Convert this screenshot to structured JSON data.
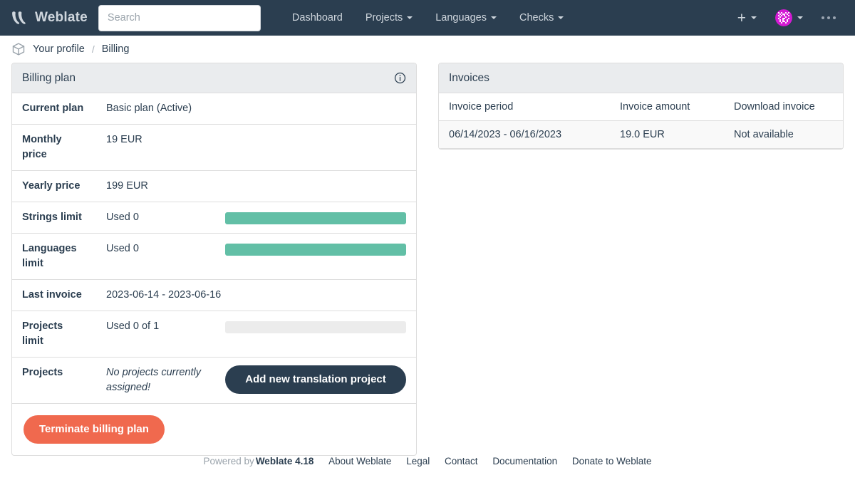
{
  "navbar": {
    "brand": "Weblate",
    "brand_logo_icon": "weblate-logo-icon",
    "search_placeholder": "Search",
    "search_value": "",
    "links": [
      {
        "label": "Dashboard",
        "has_caret": false
      },
      {
        "label": "Projects",
        "has_caret": true
      },
      {
        "label": "Languages",
        "has_caret": true
      },
      {
        "label": "Checks",
        "has_caret": true
      }
    ],
    "add_icon": "plus-icon",
    "avatar_icon": "user-avatar-identicon",
    "menu_icon": "ellipsis-icon",
    "background_color": "#2b3e50"
  },
  "breadcrumb": {
    "icon": "cube-icon",
    "items": [
      {
        "label": "Your profile",
        "current": false
      },
      {
        "label": "Billing",
        "current": true
      }
    ],
    "separator": "/"
  },
  "billing_panel": {
    "title": "Billing plan",
    "info_icon": "info-circle-icon",
    "rows": [
      {
        "key": "Current plan",
        "value": "Basic plan (Active)",
        "bar": null
      },
      {
        "key": "Monthly price",
        "value": "19 EUR",
        "bar": null
      },
      {
        "key": "Yearly price",
        "value": "199 EUR",
        "bar": null
      },
      {
        "key": "Strings limit",
        "value": "Used 0",
        "bar": {
          "percent": 100,
          "color": "#62bfa6"
        }
      },
      {
        "key": "Languages limit",
        "value": "Used 0",
        "bar": {
          "percent": 100,
          "color": "#62bfa6"
        }
      },
      {
        "key": "Last invoice",
        "value": "2023-06-14 - 2023-06-16",
        "bar": null
      },
      {
        "key": "Projects limit",
        "value": "Used 0 of 1",
        "bar": {
          "percent": 0,
          "color": "#ececec"
        }
      }
    ],
    "projects_row": {
      "key": "Projects",
      "empty_text": "No projects currently assigned!",
      "add_button_label": "Add new translation project"
    },
    "terminate_button_label": "Terminate billing plan",
    "terminate_button_color": "#f0694e"
  },
  "invoices_panel": {
    "title": "Invoices",
    "columns": [
      "Invoice period",
      "Invoice amount",
      "Download invoice"
    ],
    "rows": [
      {
        "period": "06/14/2023 - 06/16/2023",
        "amount": "19.0 EUR",
        "download": "Not available"
      }
    ]
  },
  "footer": {
    "powered_by": "Powered by",
    "version": "Weblate 4.18",
    "links": [
      "About Weblate",
      "Legal",
      "Contact",
      "Documentation",
      "Donate to Weblate"
    ]
  }
}
